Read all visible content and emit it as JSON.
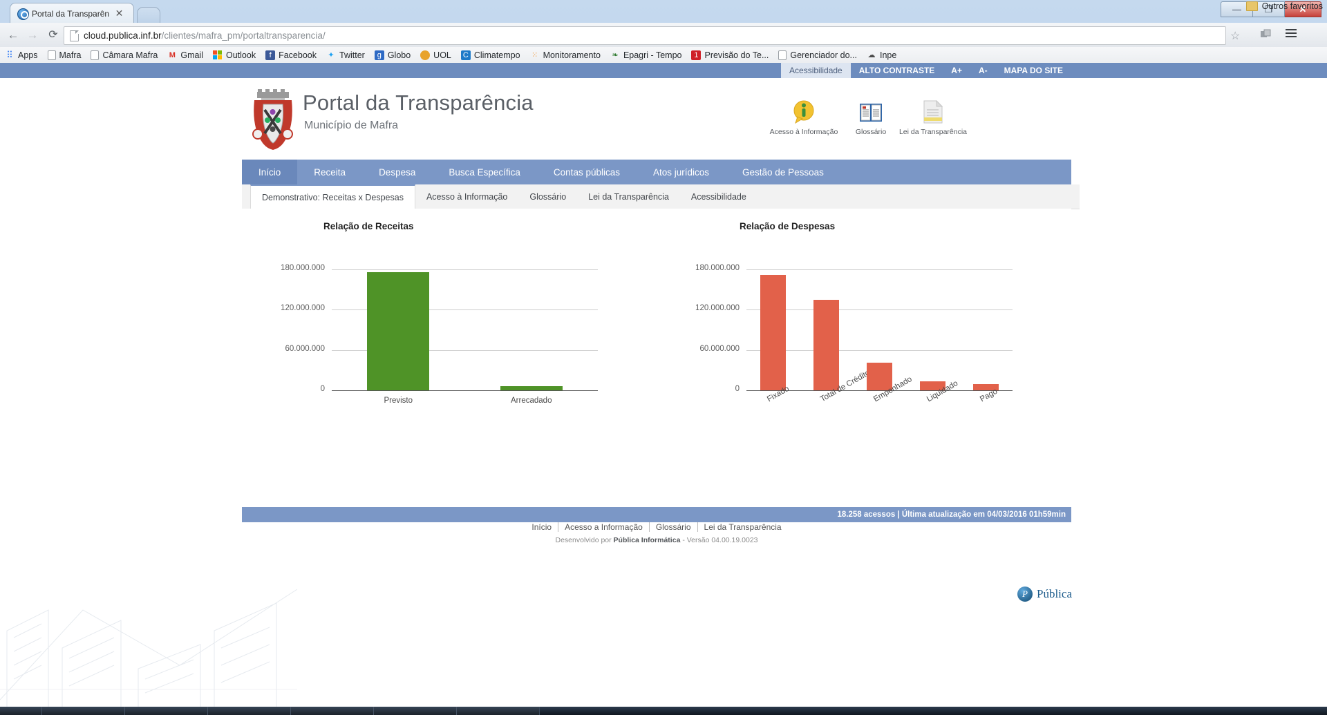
{
  "browser": {
    "tab_title": "Portal da Transparên",
    "tab_close": "✕",
    "url_host": "cloud.publica.inf.br",
    "url_path": "/clientes/mafra_pm/portaltransparencia/",
    "window_buttons": {
      "minimize": "—",
      "maximize": "❐",
      "close": "✕"
    },
    "star": "☆",
    "bookmarks": [
      {
        "label": "Apps",
        "icon": "apps-grid-icon",
        "color": "#4285f4",
        "glyph": "⠿"
      },
      {
        "label": "Mafra",
        "icon": "page-icon",
        "color": "#ffffff",
        "glyph": ""
      },
      {
        "label": "Câmara Mafra",
        "icon": "page-icon",
        "color": "#ffffff",
        "glyph": ""
      },
      {
        "label": "Gmail",
        "icon": "gmail-icon",
        "color": "#ffffff",
        "glyph": "M"
      },
      {
        "label": "Outlook",
        "icon": "outlook-icon",
        "color": "#ffffff",
        "glyph": ""
      },
      {
        "label": "Facebook",
        "icon": "facebook-icon",
        "color": "#3b5998",
        "glyph": "f"
      },
      {
        "label": "Twitter",
        "icon": "twitter-icon",
        "color": "#ffffff",
        "glyph": "🐦"
      },
      {
        "label": "Globo",
        "icon": "globo-icon",
        "color": "#2e6ac4",
        "glyph": "g"
      },
      {
        "label": "UOL",
        "icon": "uol-icon",
        "color": "#e8a32c",
        "glyph": ""
      },
      {
        "label": "Climatempo",
        "icon": "climatempo-icon",
        "color": "#1e7ac8",
        "glyph": "C"
      },
      {
        "label": "Monitoramento",
        "icon": "monitoramento-icon",
        "color": "#f2922c",
        "glyph": ""
      },
      {
        "label": "Epagri - Tempo",
        "icon": "epagri-icon",
        "color": "#ffffff",
        "glyph": ""
      },
      {
        "label": "Previsão do Te...",
        "icon": "previsao-icon",
        "color": "#cf2027",
        "glyph": ""
      },
      {
        "label": "Gerenciador do...",
        "icon": "page-icon",
        "color": "#ffffff",
        "glyph": ""
      },
      {
        "label": "Inpe",
        "icon": "inpe-icon",
        "color": "#4a4a4a",
        "glyph": ""
      }
    ],
    "other_bookmarks": "Outros favoritos"
  },
  "accessibility_bar": {
    "items": [
      {
        "label": "Acessibilidade",
        "selected": true,
        "bold": false
      },
      {
        "label": "ALTO CONTRASTE",
        "selected": false,
        "bold": true
      },
      {
        "label": "A+",
        "selected": false,
        "bold": true
      },
      {
        "label": "A-",
        "selected": false,
        "bold": true
      },
      {
        "label": "MAPA DO SITE",
        "selected": false,
        "bold": true
      }
    ]
  },
  "header": {
    "title": "Portal da Transparência",
    "subtitle": "Município de Mafra",
    "quick_links": [
      {
        "label": "Acesso à Informação",
        "icon": "info-balloon-icon"
      },
      {
        "label": "Glossário",
        "icon": "open-book-icon"
      },
      {
        "label": "Lei da Transparência",
        "icon": "document-icon"
      }
    ]
  },
  "mainnav": {
    "items": [
      {
        "label": "Início",
        "active": true
      },
      {
        "label": "Receita",
        "active": false
      },
      {
        "label": "Despesa",
        "active": false
      },
      {
        "label": "Busca Específica",
        "active": false
      },
      {
        "label": "Contas públicas",
        "active": false
      },
      {
        "label": "Atos jurídicos",
        "active": false
      },
      {
        "label": "Gestão de Pessoas",
        "active": false
      }
    ]
  },
  "tabs": {
    "items": [
      {
        "label": "Demonstrativo: Receitas x Despesas",
        "active": true
      },
      {
        "label": "Acesso à Informação",
        "active": false
      },
      {
        "label": "Glossário",
        "active": false
      },
      {
        "label": "Lei da Transparência",
        "active": false
      },
      {
        "label": "Acessibilidade",
        "active": false
      }
    ]
  },
  "footer": {
    "status": "18.258 acessos | Última atualização em 04/03/2016 01h59min",
    "links": [
      "Início",
      "Acesso a Informação",
      "Glossário",
      "Lei da Transparência"
    ],
    "developed_prefix": "Desenvolvido por ",
    "developed_by": "Pública Informática",
    "version": " - Versão 04.00.19.0023",
    "logo_text": "Pública",
    "logo_mark": "P"
  },
  "chart_data": [
    {
      "type": "bar",
      "title": "Relação de Receitas",
      "categories": [
        "Previsto",
        "Arrecadado"
      ],
      "values": [
        175000000,
        6000000
      ],
      "series": [
        {
          "name": "Receitas",
          "values": [
            175000000,
            6000000
          ]
        }
      ],
      "xlabel": "",
      "ylabel": "",
      "ylim": [
        0,
        200000000
      ],
      "yticks": [
        0,
        60000000,
        120000000,
        180000000
      ],
      "ytick_labels": [
        "0",
        "60.000.000",
        "120.000.000",
        "180.000.000"
      ],
      "grid": true,
      "legend": false,
      "bar_color": "#4f9327",
      "rotated_xlabels": false
    },
    {
      "type": "bar",
      "title": "Relação de Despesas",
      "categories": [
        "Fixado",
        "Total de Créditos",
        "Empenhado",
        "Liquidado",
        "Pago"
      ],
      "values": [
        171000000,
        134000000,
        41000000,
        13000000,
        9000000
      ],
      "series": [
        {
          "name": "Despesas",
          "values": [
            171000000,
            134000000,
            41000000,
            13000000,
            9000000
          ]
        }
      ],
      "xlabel": "",
      "ylabel": "",
      "ylim": [
        0,
        200000000
      ],
      "yticks": [
        0,
        60000000,
        120000000,
        180000000
      ],
      "ytick_labels": [
        "0",
        "60.000.000",
        "120.000.000",
        "180.000.000"
      ],
      "grid": true,
      "legend": false,
      "bar_color": "#e2614a",
      "rotated_xlabels": true
    }
  ]
}
